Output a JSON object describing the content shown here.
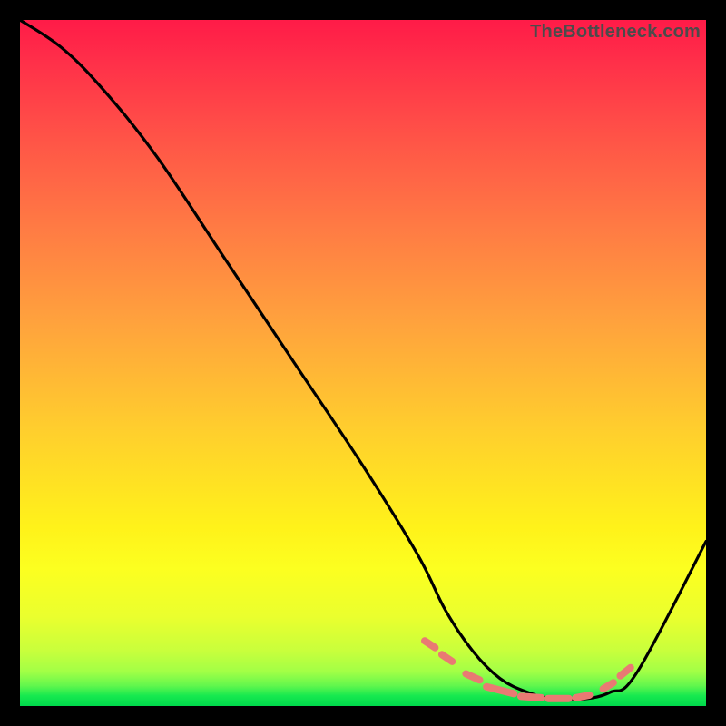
{
  "watermark": "TheBottleneck.com",
  "chart_data": {
    "type": "line",
    "title": "",
    "xlabel": "",
    "ylabel": "",
    "xlim": [
      0,
      100
    ],
    "ylim": [
      0,
      100
    ],
    "grid": false,
    "series": [
      {
        "name": "bottleneck-curve",
        "x": [
          0,
          6,
          12,
          20,
          30,
          40,
          50,
          58,
          62,
          66,
          70,
          74,
          78,
          82,
          86,
          90,
          100
        ],
        "values": [
          100,
          96,
          90,
          80,
          65,
          50,
          35,
          22,
          14,
          8,
          4,
          2,
          1,
          1,
          2,
          5,
          24
        ],
        "color": "#000000"
      }
    ],
    "annotations": {
      "dashed_marker_color": "#e97a73",
      "dashed_marker_segments": [
        {
          "x": [
            59,
            60.5
          ],
          "y": [
            9.5,
            8.5
          ]
        },
        {
          "x": [
            61.5,
            63
          ],
          "y": [
            7.5,
            6.5
          ]
        },
        {
          "x": [
            65,
            67
          ],
          "y": [
            4.7,
            3.8
          ]
        },
        {
          "x": [
            68,
            72
          ],
          "y": [
            2.8,
            1.8
          ]
        },
        {
          "x": [
            73,
            76
          ],
          "y": [
            1.4,
            1.2
          ]
        },
        {
          "x": [
            77,
            80
          ],
          "y": [
            1.1,
            1.1
          ]
        },
        {
          "x": [
            81,
            83
          ],
          "y": [
            1.2,
            1.6
          ]
        },
        {
          "x": [
            85,
            86.5
          ],
          "y": [
            2.5,
            3.4
          ]
        },
        {
          "x": [
            87.5,
            89
          ],
          "y": [
            4.4,
            5.6
          ]
        }
      ]
    }
  }
}
